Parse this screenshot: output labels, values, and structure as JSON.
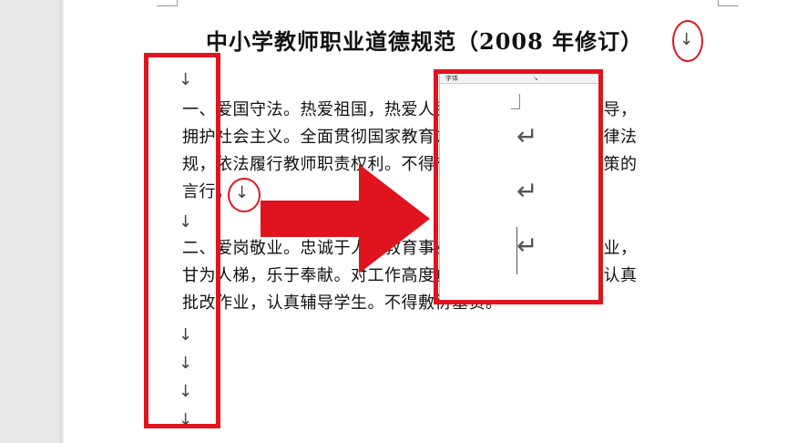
{
  "document": {
    "title": "中小学教师职业道德规范（2008 年修订）",
    "title_mark": "↓",
    "paragraph_marks": [
      "↓",
      "↓",
      "↓",
      "↓",
      "↓",
      "↓"
    ],
    "paragraph1_lines": [
      "一、爱国守法。热爱祖国，热爱人民，拥护中国共产党领导，",
      "拥护社会主义。全面贯彻国家教育方针，自觉遵守教育法律法",
      "规，依法履行教师职责权利。不得有违背党和国家方针政策的",
      "言行。"
    ],
    "paragraph1_end_mark": "↓",
    "paragraph2_lines": [
      "二、爱岗敬业。忠诚于人民教育事业，志存高远，勤恳敬业，",
      "甘为人梯，乐于奉献。对工作高度负责，认真备课上课，认真",
      "批改作业，认真辅导学生。不得敷衍塞责。"
    ]
  },
  "zoom_panel": {
    "header_label": "字体",
    "header_launcher": "↘",
    "enter_marks": [
      "↵",
      "↵",
      "↵"
    ]
  },
  "colors": {
    "highlight": "#e0141e",
    "page": "#ffffff",
    "background": "#e8e8e8"
  },
  "icons": {
    "pointer_arrow": "right-arrow",
    "manual_line_break": "down-arrow",
    "paragraph_mark": "enter-arrow"
  }
}
